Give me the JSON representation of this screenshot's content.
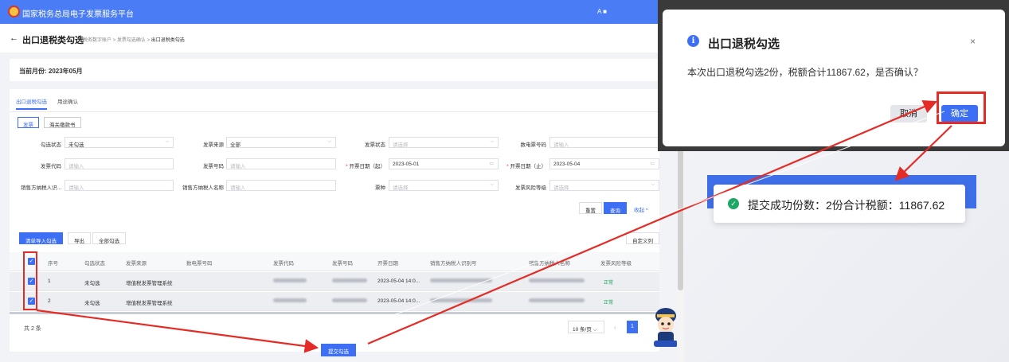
{
  "app": {
    "title": "国家税务总局电子发票服务平台",
    "user": "A ■"
  },
  "header": {
    "back": "←",
    "page_title": "出口退税类勾选",
    "breadcrumb": [
      "税务数字账户",
      "发票勾选确认",
      "出口退税类勾选"
    ],
    "sep": ">"
  },
  "month": "当前月份: 2023年05月",
  "tabs": [
    "出口退税勾选",
    "用途确认"
  ],
  "doc_types": [
    "发票",
    "海关缴款书"
  ],
  "filters": {
    "check_status": {
      "label": "勾选状态",
      "value": "未勾选"
    },
    "invoice_source": {
      "label": "发票来源",
      "value": "全部"
    },
    "invoice_status": {
      "label": "发票状态",
      "placeholder": "请选择"
    },
    "digital_no": {
      "label": "数电票号码",
      "placeholder": "请输入"
    },
    "invoice_code": {
      "label": "发票代码",
      "placeholder": "请输入"
    },
    "invoice_no": {
      "label": "发票号码",
      "placeholder": "请输入"
    },
    "date_start": {
      "label": "开票日期（起）",
      "value": "2023-05-01"
    },
    "date_end": {
      "label": "开票日期（止）",
      "value": "2023-05-04"
    },
    "seller_tax_id": {
      "label": "销售方纳税人识...",
      "placeholder": "请输入"
    },
    "seller_name": {
      "label": "销售方纳税人名称",
      "placeholder": "请输入"
    },
    "invoice_kind": {
      "label": "票种",
      "placeholder": "请选择"
    },
    "risk_level": {
      "label": "发票风险等级",
      "placeholder": "请选择"
    }
  },
  "actions": {
    "reset": "重置",
    "query": "查询",
    "collapse": "收起 ^",
    "import_check": "清单导入勾选",
    "export": "导出",
    "check_all": "全部勾选",
    "custom_columns": "自定义列"
  },
  "table": {
    "columns": [
      "序号",
      "勾选状态",
      "发票来源",
      "数电票号码",
      "发票代码",
      "发票号码",
      "开票日期",
      "销售方纳税人识别号",
      "销售方纳税人名称",
      "发票风险等级"
    ],
    "rows": [
      {
        "no": "1",
        "status": "未勾选",
        "source": "增值税发票管理系统",
        "date": "2023-05-04 14:0...",
        "risk": "正常"
      },
      {
        "no": "2",
        "status": "未勾选",
        "source": "增值税发票管理系统",
        "date": "2023-05-04 14:0...",
        "risk": "正常"
      }
    ]
  },
  "footer": {
    "total": "共 2 条",
    "page_size": "10 条/页",
    "page": "1",
    "submit": "提交勾选"
  },
  "dialog": {
    "title": "出口退税勾选",
    "message": "本次出口退税勾选2份，税额合计11867.62，是否确认？",
    "cancel": "取消",
    "confirm": "确定",
    "close": "×"
  },
  "toast": {
    "text": "提交成功份数：2份合计税额：11867.62"
  },
  "colors": {
    "primary": "#3d6ff5",
    "highlight": "#e52b25",
    "success": "#1fa766"
  }
}
